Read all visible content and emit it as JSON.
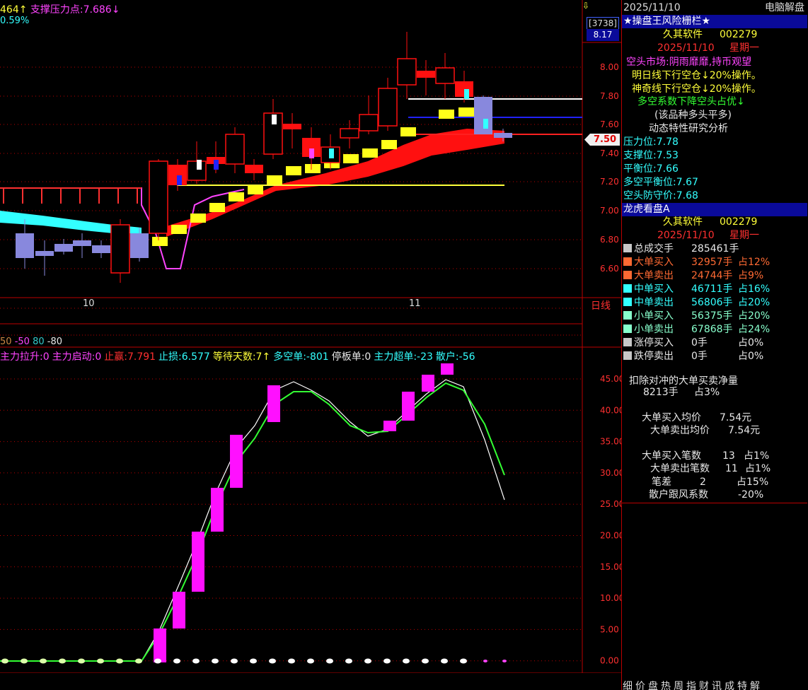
{
  "price_panel": {
    "header": {
      "resistance_prefix": "464↑",
      "support_label": "支撑压力点:7.686↓",
      "pct": "0.59%"
    },
    "price_axis": [
      "8.00",
      "7.80",
      "7.60",
      "7.40",
      "7.20",
      "7.00",
      "6.80",
      "6.60"
    ],
    "current_price": "7.50",
    "count_badge": "[3738]",
    "max_price": "8.17",
    "date_labels": [
      "10",
      "11"
    ],
    "period_label": "日线",
    "volume_header": {
      "v1": "50",
      "v2": "-50",
      "v3": "80",
      "v4": "-80"
    }
  },
  "indicator_panel": {
    "labels": [
      {
        "text": "主力拉升:0",
        "color": "#ff44ff"
      },
      {
        "text": "主力启动:0",
        "color": "#ff44ff"
      },
      {
        "text": "止赢:7.791",
        "color": "#ff3030"
      },
      {
        "text": "止损:6.577",
        "color": "#33ffff"
      },
      {
        "text": "等待天数:7↑",
        "color": "#ffff3a"
      },
      {
        "text": "多空单:-801",
        "color": "#33ffff"
      },
      {
        "text": "停板单:0",
        "color": "#e8e8e8"
      },
      {
        "text": "主力超单:-23",
        "color": "#33ffff"
      },
      {
        "text": "散户:-56",
        "color": "#33ffff"
      }
    ],
    "axis": [
      "45.00",
      "40.00",
      "35.00",
      "30.00",
      "25.00",
      "20.00",
      "15.00",
      "10.00",
      "5.00",
      "0.00"
    ]
  },
  "sidebar": {
    "date": "2025/11/10",
    "title_right": "电脑解盘",
    "section1_title": "★操盘王风险栅栏★",
    "stock_name": "久其软件",
    "stock_code": "002279",
    "weekday": "星期一",
    "lines": [
      {
        "text": "空头市场:阴雨靡靡,持币观望",
        "color": "#ff44ff"
      },
      {
        "text": "明日线下行空仓↓20%操作。",
        "color": "#ffff3a"
      },
      {
        "text": "神奇线下行空仓↓20%操作。",
        "color": "#ffff3a"
      },
      {
        "text": "多空系数下降空头占优↓",
        "color": "#33ff33"
      },
      {
        "text": "(该品种多头平多)",
        "color": "#e8e8e8"
      },
      {
        "text": "动态特性研究分析",
        "color": "#e8e8e8"
      }
    ],
    "levels": [
      {
        "label": "压力位:",
        "value": "7.78"
      },
      {
        "label": "支撑位:",
        "value": "7.53"
      },
      {
        "label": "平衡位:",
        "value": "7.66"
      },
      {
        "label": "多空平衡位:",
        "value": "7.67"
      },
      {
        "label": "空头防守价:",
        "value": "7.68"
      }
    ],
    "section2_title": "龙虎看盘A",
    "flows": [
      {
        "label": "总成交手",
        "value": "285461手",
        "pct": "",
        "sq": "#c8c8c8",
        "lc": "#e8e8e8",
        "vc": "#e8e8e8"
      },
      {
        "label": "大单买入",
        "value": "32957手",
        "pct": "占12%",
        "sq": "#ff6a33",
        "lc": "#ff6a33",
        "vc": "#ff6a33"
      },
      {
        "label": "大单卖出",
        "value": "24744手",
        "pct": "占9%",
        "sq": "#ff6a33",
        "lc": "#ff6a33",
        "vc": "#ff6a33"
      },
      {
        "label": "中单买入",
        "value": "46711手",
        "pct": "占16%",
        "sq": "#33ffff",
        "lc": "#33ffff",
        "vc": "#33ffff"
      },
      {
        "label": "中单卖出",
        "value": "56806手",
        "pct": "占20%",
        "sq": "#33ffff",
        "lc": "#33ffff",
        "vc": "#33ffff"
      },
      {
        "label": "小单买入",
        "value": "56375手",
        "pct": "占20%",
        "sq": "#88ffcc",
        "lc": "#88ffcc",
        "vc": "#88ffcc"
      },
      {
        "label": "小单卖出",
        "value": "67868手",
        "pct": "占24%",
        "sq": "#88ffcc",
        "lc": "#88ffcc",
        "vc": "#88ffcc"
      },
      {
        "label": "涨停买入",
        "value": "0手",
        "pct": "占0%",
        "sq": "#c8c8c8",
        "lc": "#e8e8e8",
        "vc": "#e8e8e8"
      },
      {
        "label": "跌停卖出",
        "value": "0手",
        "pct": "占0%",
        "sq": "#c8c8c8",
        "lc": "#e8e8e8",
        "vc": "#e8e8e8"
      }
    ],
    "net_title": "扣除对冲的大单买卖净量",
    "net_value": "8213手",
    "net_pct": "占3%",
    "avg_buy_label": "大单买入均价",
    "avg_buy": "7.54元",
    "avg_sell_label": "大单卖出均价",
    "avg_sell": "7.54元",
    "cnt_buy_label": "大单买入笔数",
    "cnt_buy": "13",
    "cnt_buy_pct": "占1%",
    "cnt_sell_label": "大单卖出笔数",
    "cnt_sell": "11",
    "cnt_sell_pct": "占1%",
    "diff_label": "笔差",
    "diff": "2",
    "diff_pct": "占15%",
    "retail_label": "散户跟风系数",
    "retail": "-20%"
  },
  "bottom_tabs": [
    "细",
    "价",
    "盘",
    "热",
    "周",
    "指",
    "财",
    "讯",
    "成",
    "特",
    "解"
  ]
}
